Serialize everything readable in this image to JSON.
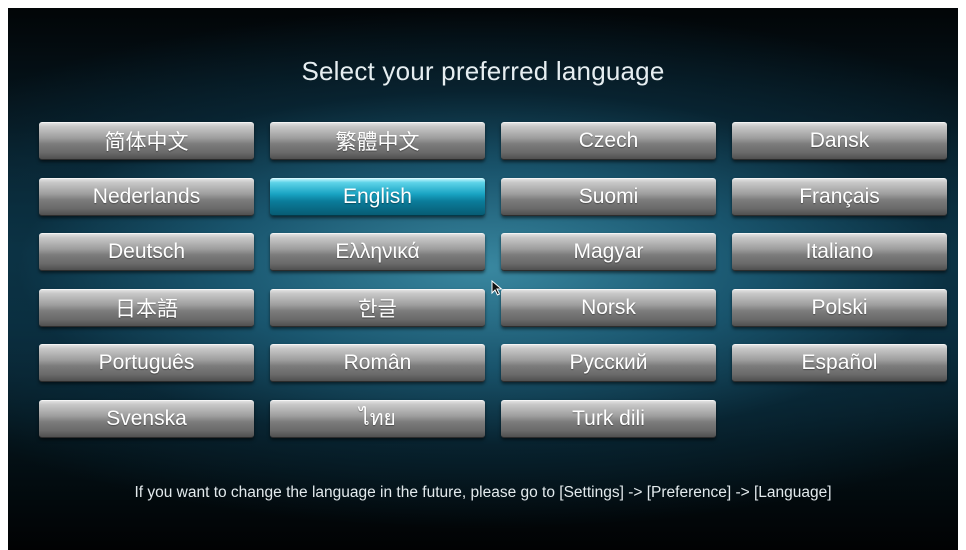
{
  "title": "Select your preferred language",
  "selected_language": "English",
  "languages": [
    "简体中文",
    "繁體中文",
    "Czech",
    "Dansk",
    "Nederlands",
    "English",
    "Suomi",
    "Français",
    "Deutsch",
    "Ελληνικά",
    "Magyar",
    "Italiano",
    "日本語",
    "한글",
    "Norsk",
    "Polski",
    "Português",
    "Român",
    "Русский",
    "Español",
    "Svenska",
    "ไทย",
    "Turk dili"
  ],
  "footer_hint": "If you want to change the language in the future,  please go to [Settings] -> [Preference] -> [Language]",
  "colors": {
    "selected_accent": "#19a3c2",
    "button_gray": "#8a8a8a",
    "background": "#0d3a4d"
  },
  "icons": {
    "cursor": "mouse-pointer-icon"
  }
}
